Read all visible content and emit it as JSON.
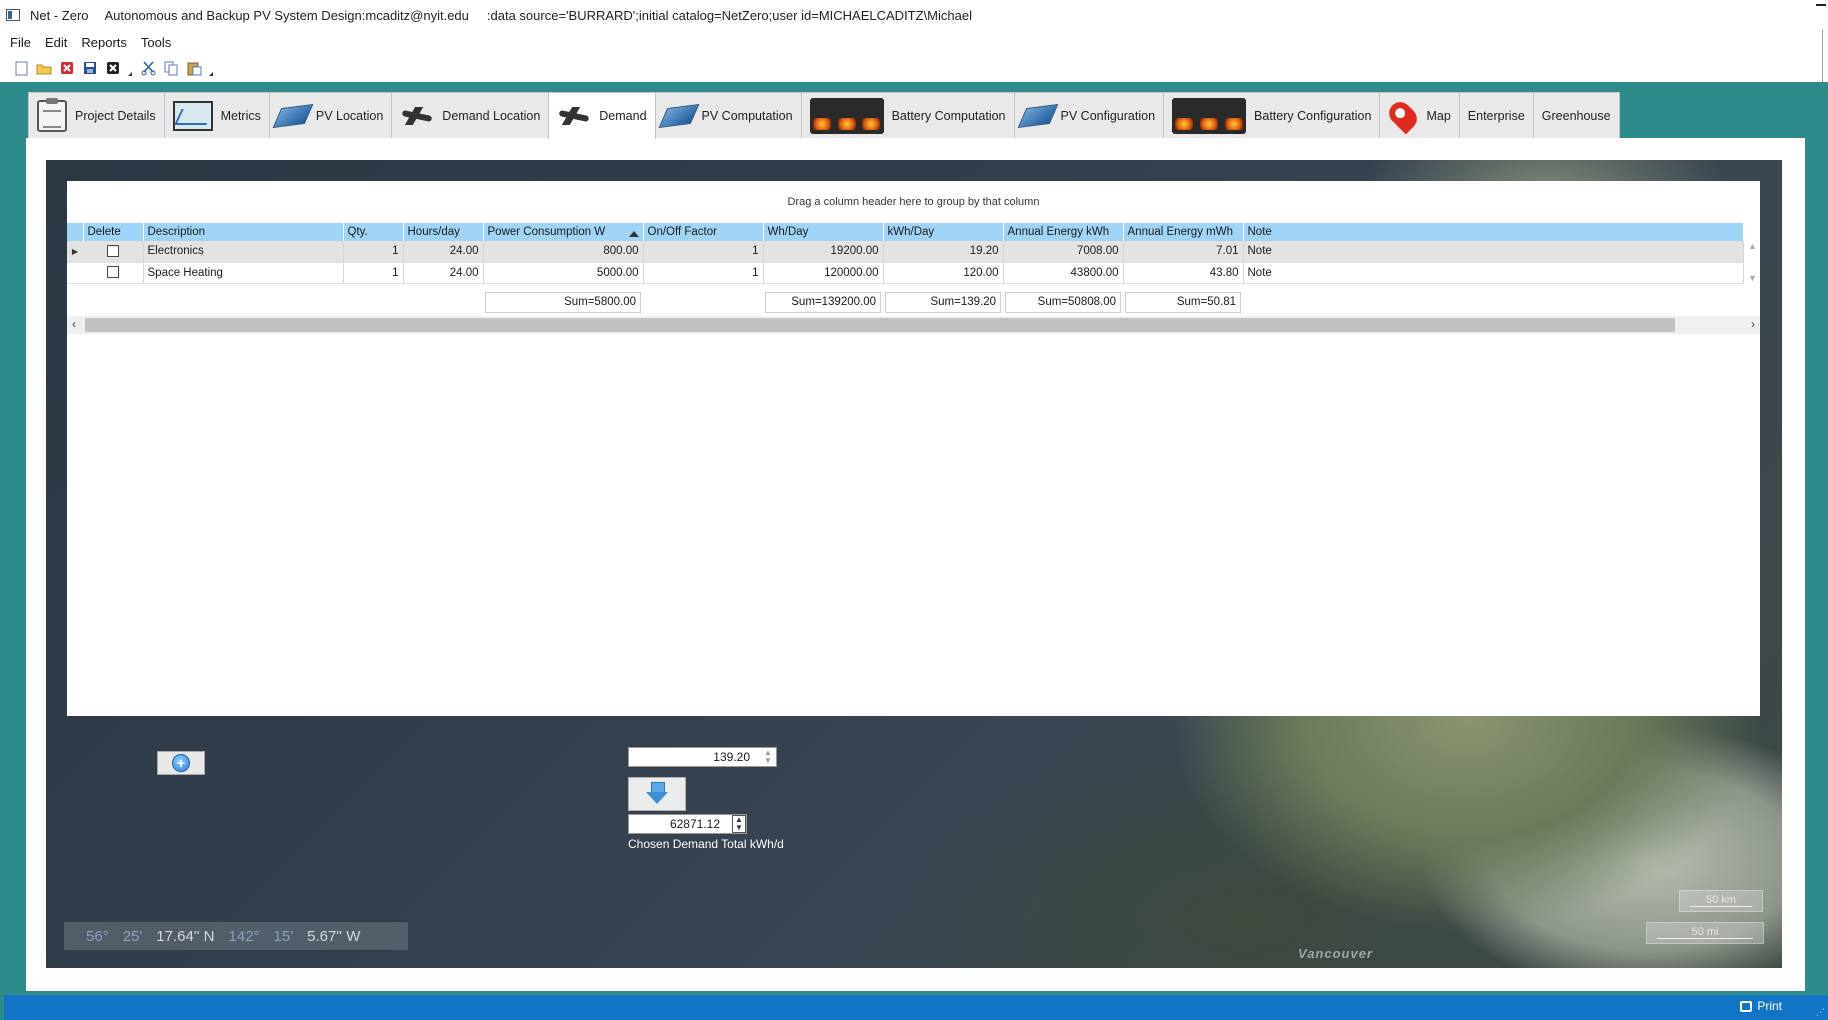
{
  "titlebar": {
    "app_name": "Net - Zero",
    "subtitle": "Autonomous and Backup PV System Design:mcaditz@nyit.edu",
    "connection": ":data source='BURRARD';initial catalog=NetZero;user id=MICHAELCADITZ\\Michael"
  },
  "menu": [
    "File",
    "Edit",
    "Reports",
    "Tools"
  ],
  "toolbar_icons": [
    "new-icon",
    "open-folder-icon",
    "delete-icon",
    "save-icon",
    "close-icon",
    "cut-icon",
    "copy-icon",
    "paste-icon"
  ],
  "tabs": [
    {
      "label": "Project Details",
      "icon": "clipboard-gear-icon"
    },
    {
      "label": "Metrics",
      "icon": "chart-monitor-icon"
    },
    {
      "label": "PV Location",
      "icon": "solar-panel-icon"
    },
    {
      "label": "Demand Location",
      "icon": "aircraft-icon"
    },
    {
      "label": "Demand",
      "icon": "aircraft-icon",
      "active": true
    },
    {
      "label": "PV Computation",
      "icon": "solar-panel-icon"
    },
    {
      "label": "Battery Computation",
      "icon": "battery-bank-icon"
    },
    {
      "label": "PV Configuration",
      "icon": "solar-panel-icon"
    },
    {
      "label": "Battery Configuration",
      "icon": "battery-bank-icon"
    },
    {
      "label": "Map",
      "icon": "map-pin-icon"
    },
    {
      "label": "Enterprise",
      "icon": ""
    },
    {
      "label": "Greenhouse",
      "icon": ""
    }
  ],
  "grid": {
    "group_hint": "Drag a column header here to group by that column",
    "columns": [
      "Delete",
      "Description",
      "Qty.",
      "Hours/day",
      "Power Consumption W",
      "On/Off Factor",
      "Wh/Day",
      "kWh/Day",
      "Annual Energy kWh",
      "Annual Energy mWh",
      "Note"
    ],
    "rows": [
      {
        "delete": false,
        "description": "Electronics",
        "qty": "1",
        "hours": "24.00",
        "power": "800.00",
        "factor": "1",
        "wh_day": "19200.00",
        "kwh_day": "19.20",
        "annual_kwh": "7008.00",
        "annual_mwh": "7.01",
        "note": "Note"
      },
      {
        "delete": false,
        "description": "Space Heating",
        "qty": "1",
        "hours": "24.00",
        "power": "5000.00",
        "factor": "1",
        "wh_day": "120000.00",
        "kwh_day": "120.00",
        "annual_kwh": "43800.00",
        "annual_mwh": "43.80",
        "note": "Note"
      }
    ],
    "sums": {
      "power": "Sum=5800.00",
      "wh_day": "Sum=139200.00",
      "kwh_day": "Sum=139.20",
      "annual_kwh": "Sum=50808.00",
      "annual_mwh": "Sum=50.81"
    }
  },
  "controls": {
    "demand_value": "139.20",
    "chosen_demand_value": "62871.12",
    "chosen_demand_label": "Chosen Demand Total kWh/d"
  },
  "map": {
    "coords": {
      "lat_deg": "56°",
      "lat_min": "25'",
      "lat_sec": "17.64'' N",
      "lon_deg": "142°",
      "lon_min": "15'",
      "lon_sec": "5.67'' W"
    },
    "scale_km": "50 km",
    "scale_mi": "50 mi",
    "place_label": "Vancouver"
  },
  "statusbar": {
    "print_label": "Print"
  }
}
